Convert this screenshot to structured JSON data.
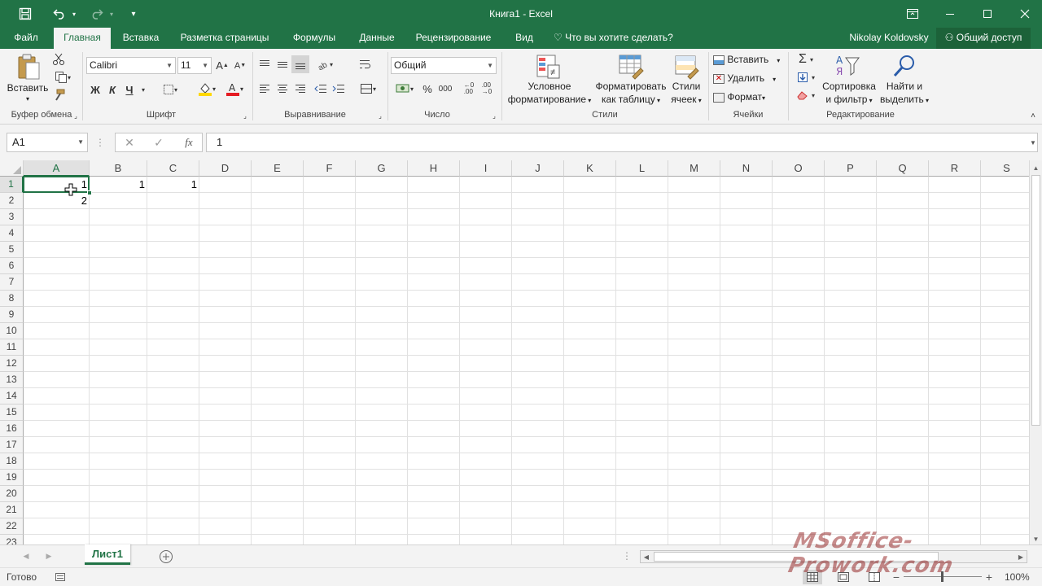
{
  "window": {
    "title": "Книга1 - Excel",
    "user": "Nikolay Koldovsky",
    "share_label": "Общий доступ"
  },
  "tabs": [
    "Файл",
    "Главная",
    "Вставка",
    "Разметка страницы",
    "Формулы",
    "Данные",
    "Рецензирование",
    "Вид"
  ],
  "tell_me": "Что вы хотите сделать?",
  "ribbon": {
    "clipboard": {
      "paste": "Вставить",
      "group": "Буфер обмена"
    },
    "font": {
      "name": "Calibri",
      "size": "11",
      "bold": "Ж",
      "italic": "К",
      "underline": "Ч",
      "group": "Шрифт"
    },
    "alignment": {
      "group": "Выравнивание"
    },
    "number": {
      "format": "Общий",
      "percent": "%",
      "thousands": "000",
      "group": "Число"
    },
    "styles": {
      "conditional_1": "Условное",
      "conditional_2": "форматирование",
      "table_1": "Форматировать",
      "table_2": "как таблицу",
      "cell_1": "Стили",
      "cell_2": "ячеек",
      "group": "Стили"
    },
    "cells": {
      "insert": "Вставить",
      "delete": "Удалить",
      "format": "Формат",
      "group": "Ячейки"
    },
    "editing": {
      "sort_1": "Сортировка",
      "sort_2": "и фильтр",
      "find_1": "Найти и",
      "find_2": "выделить",
      "group": "Редактирование"
    }
  },
  "formula_bar": {
    "name_box": "A1",
    "fx": "fx",
    "value": "1"
  },
  "columns": [
    "A",
    "B",
    "C",
    "D",
    "E",
    "F",
    "G",
    "H",
    "I",
    "J",
    "K",
    "L",
    "M",
    "N",
    "O",
    "P",
    "Q",
    "R",
    "S"
  ],
  "rows": [
    "1",
    "2",
    "3",
    "4",
    "5",
    "6",
    "7",
    "8",
    "9",
    "10",
    "11",
    "12",
    "13",
    "14",
    "15",
    "16",
    "17",
    "18",
    "19",
    "20",
    "21",
    "22",
    "23"
  ],
  "cells": {
    "A1": "1",
    "B1": "1",
    "C1": "1",
    "A2": "2"
  },
  "sheet": {
    "name": "Лист1"
  },
  "status": {
    "ready": "Готово",
    "zoom": "100%"
  },
  "watermark": "MSoffice-Prowork.com",
  "colors": {
    "accent": "#217346",
    "ribbon_bg": "#f3f3f3",
    "grid": "#e1e1e1"
  }
}
